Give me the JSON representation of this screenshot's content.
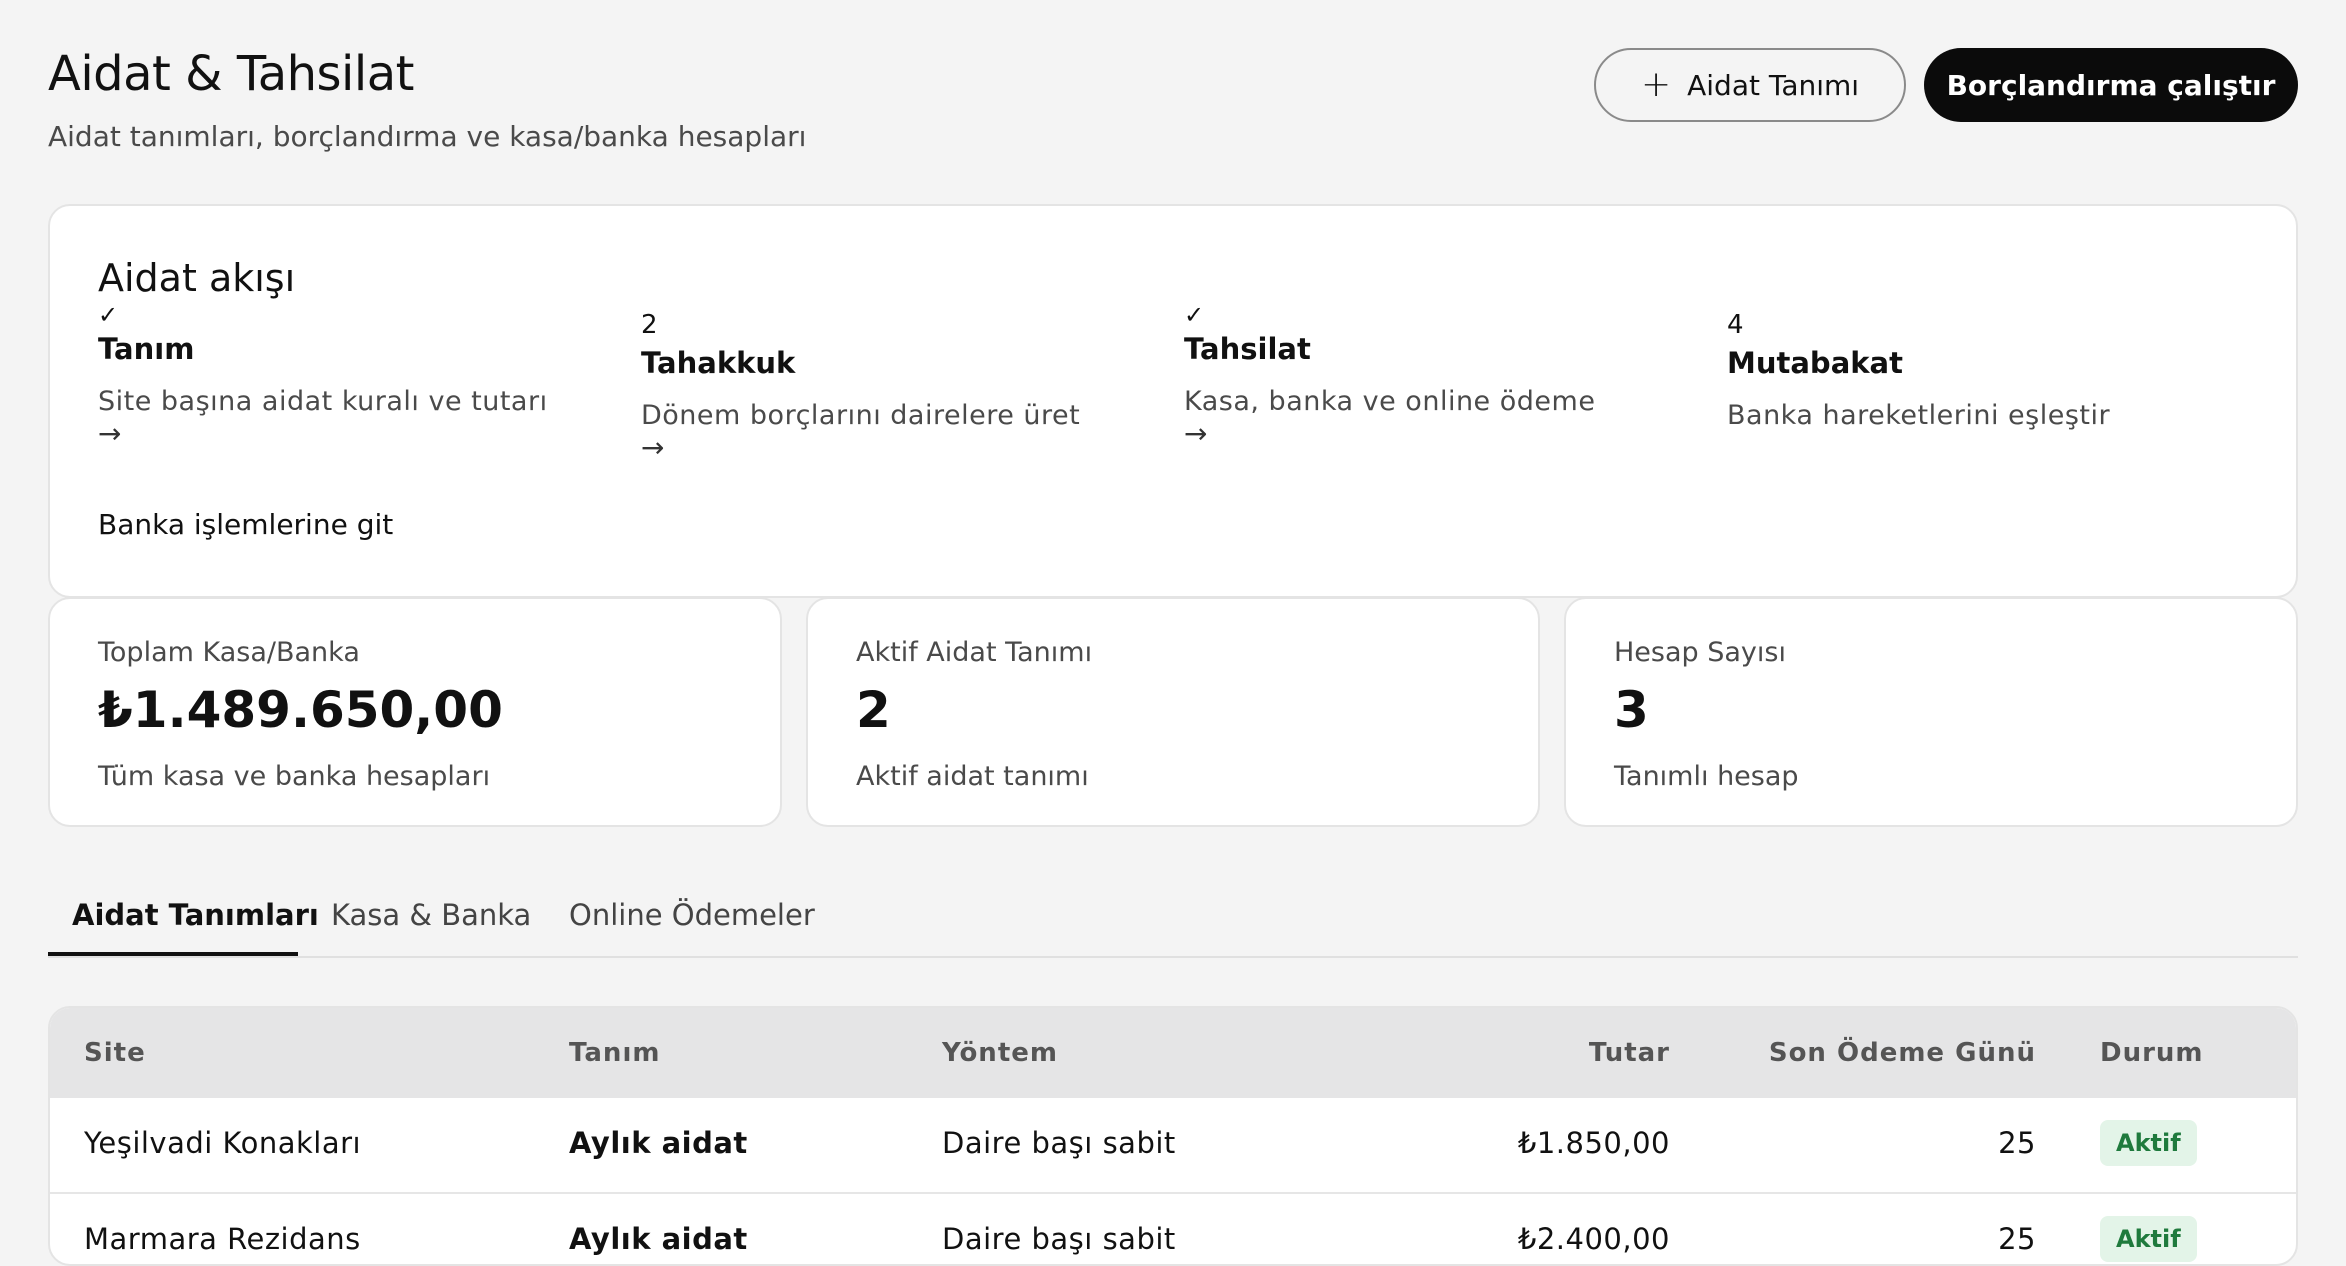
{
  "header": {
    "title": "Aidat & Tahsilat",
    "subtitle": "Aidat tanımları, borçlandırma ve kasa/banka hesapları",
    "add_button_label": "Aidat Tanımı",
    "run_button_label": "Borçlandırma çalıştır"
  },
  "flow": {
    "title": "Aidat akışı",
    "steps": [
      {
        "marker": "✓",
        "name": "Tanım",
        "desc": "Site başına aidat kuralı ve tutarı",
        "arrow": "→"
      },
      {
        "marker": "2",
        "name": "Tahakkuk",
        "desc": "Dönem borçlarını dairelere üret",
        "arrow": "→"
      },
      {
        "marker": "✓",
        "name": "Tahsilat",
        "desc": "Kasa, banka ve online ödeme",
        "arrow": "→"
      },
      {
        "marker": "4",
        "name": "Mutabakat",
        "desc": "Banka hareketlerini eşleştir"
      }
    ],
    "bank_link": "Banka işlemlerine git"
  },
  "stats": [
    {
      "label": "Toplam Kasa/Banka",
      "value": "₺1.489.650,00",
      "desc": "Tüm kasa ve banka hesapları"
    },
    {
      "label": "Aktif Aidat Tanımı",
      "value": "2",
      "desc": "Aktif aidat tanımı"
    },
    {
      "label": "Hesap Sayısı",
      "value": "3",
      "desc": "Tanımlı hesap"
    }
  ],
  "tabs": [
    {
      "label": "Aidat Tanımları",
      "active": true
    },
    {
      "label": "Kasa & Banka",
      "active": false
    },
    {
      "label": "Online Ödemeler",
      "active": false
    }
  ],
  "table": {
    "columns": [
      "Site",
      "Tanım",
      "Yöntem",
      "Tutar",
      "Son Ödeme Günü",
      "Durum"
    ],
    "rows": [
      {
        "site": "Yeşilvadi Konakları",
        "tanim": "Aylık aidat",
        "yontem": "Daire başı sabit",
        "tutar": "₺1.850,00",
        "gun": "25",
        "durum": "Aktif"
      },
      {
        "site": "Marmara Rezidans",
        "tanim": "Aylık aidat",
        "yontem": "Daire başı sabit",
        "tutar": "₺2.400,00",
        "gun": "25",
        "durum": "Aktif"
      }
    ]
  },
  "colors": {
    "background": "#f4f4f4",
    "primary": "#0b0b0b",
    "badge_bg": "#e3f4e8",
    "badge_text": "#1f7a3d"
  },
  "icons": {
    "plus": "plus-icon",
    "check": "check-icon",
    "arrow": "arrow-right-icon"
  }
}
